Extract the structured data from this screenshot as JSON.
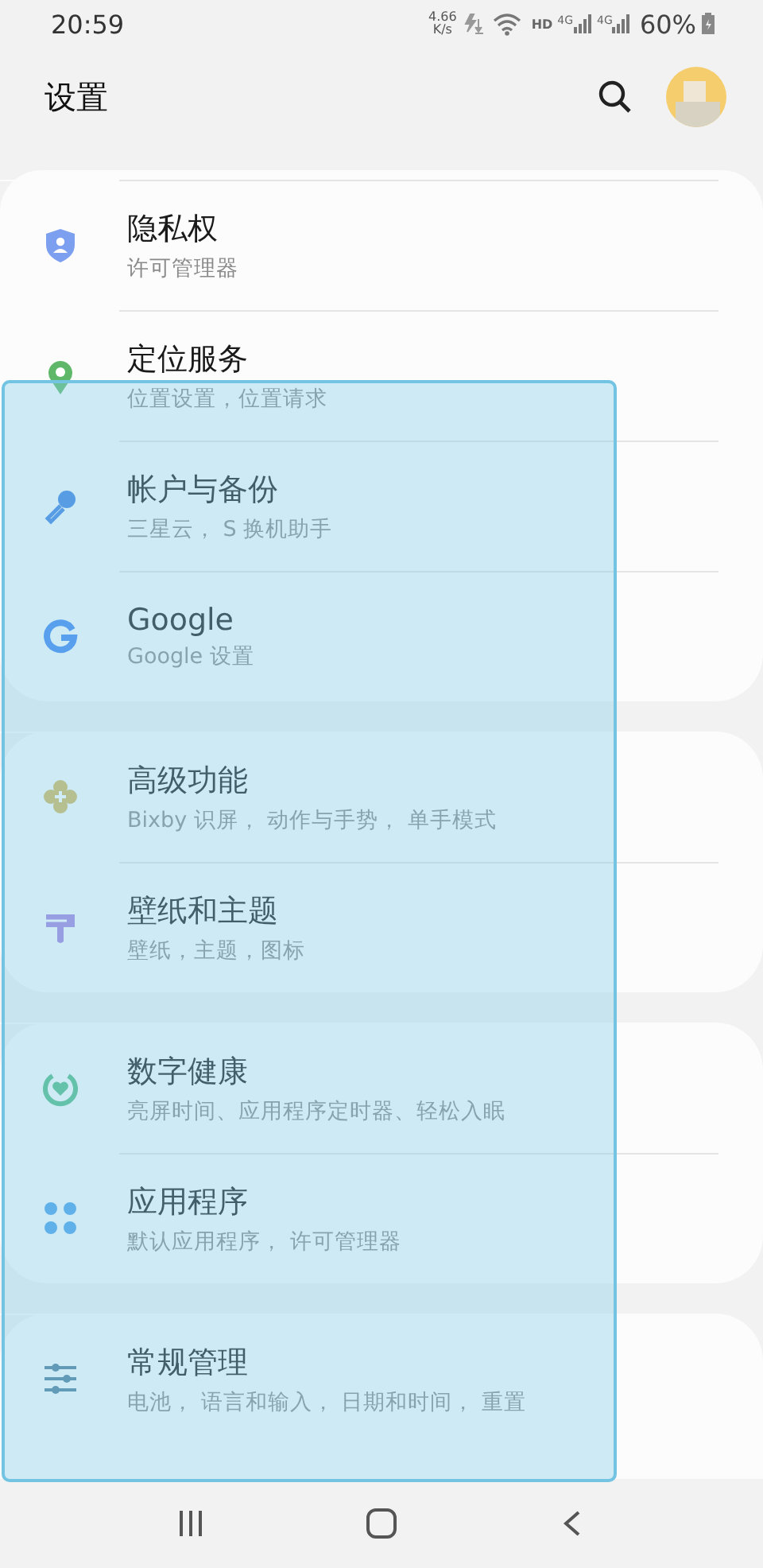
{
  "status_bar": {
    "time": "20:59",
    "speed_value": "4.66",
    "speed_unit": "K/s",
    "hd": "HD",
    "network_1": "4G",
    "network_2": "4G",
    "battery": "60%"
  },
  "header": {
    "title": "设置"
  },
  "groups": [
    {
      "items": [
        {
          "title": "隐私权",
          "subtitle": "许可管理器"
        },
        {
          "title": "定位服务",
          "subtitle": "位置设置，位置请求"
        },
        {
          "title": "帐户与备份",
          "subtitle": "三星云， S 换机助手"
        },
        {
          "title": "Google",
          "subtitle": "Google 设置"
        }
      ]
    },
    {
      "items": [
        {
          "title": "高级功能",
          "subtitle": "Bixby 识屏， 动作与手势， 单手模式"
        },
        {
          "title": "壁纸和主题",
          "subtitle": "壁纸，主题，图标"
        }
      ]
    },
    {
      "items": [
        {
          "title": "数字健康",
          "subtitle": "亮屏时间、应用程序定时器、轻松入眠"
        },
        {
          "title": "应用程序",
          "subtitle": "默认应用程序， 许可管理器"
        }
      ]
    },
    {
      "items": [
        {
          "title": "常规管理",
          "subtitle": "电池， 语言和输入， 日期和时间， 重置"
        }
      ]
    }
  ]
}
